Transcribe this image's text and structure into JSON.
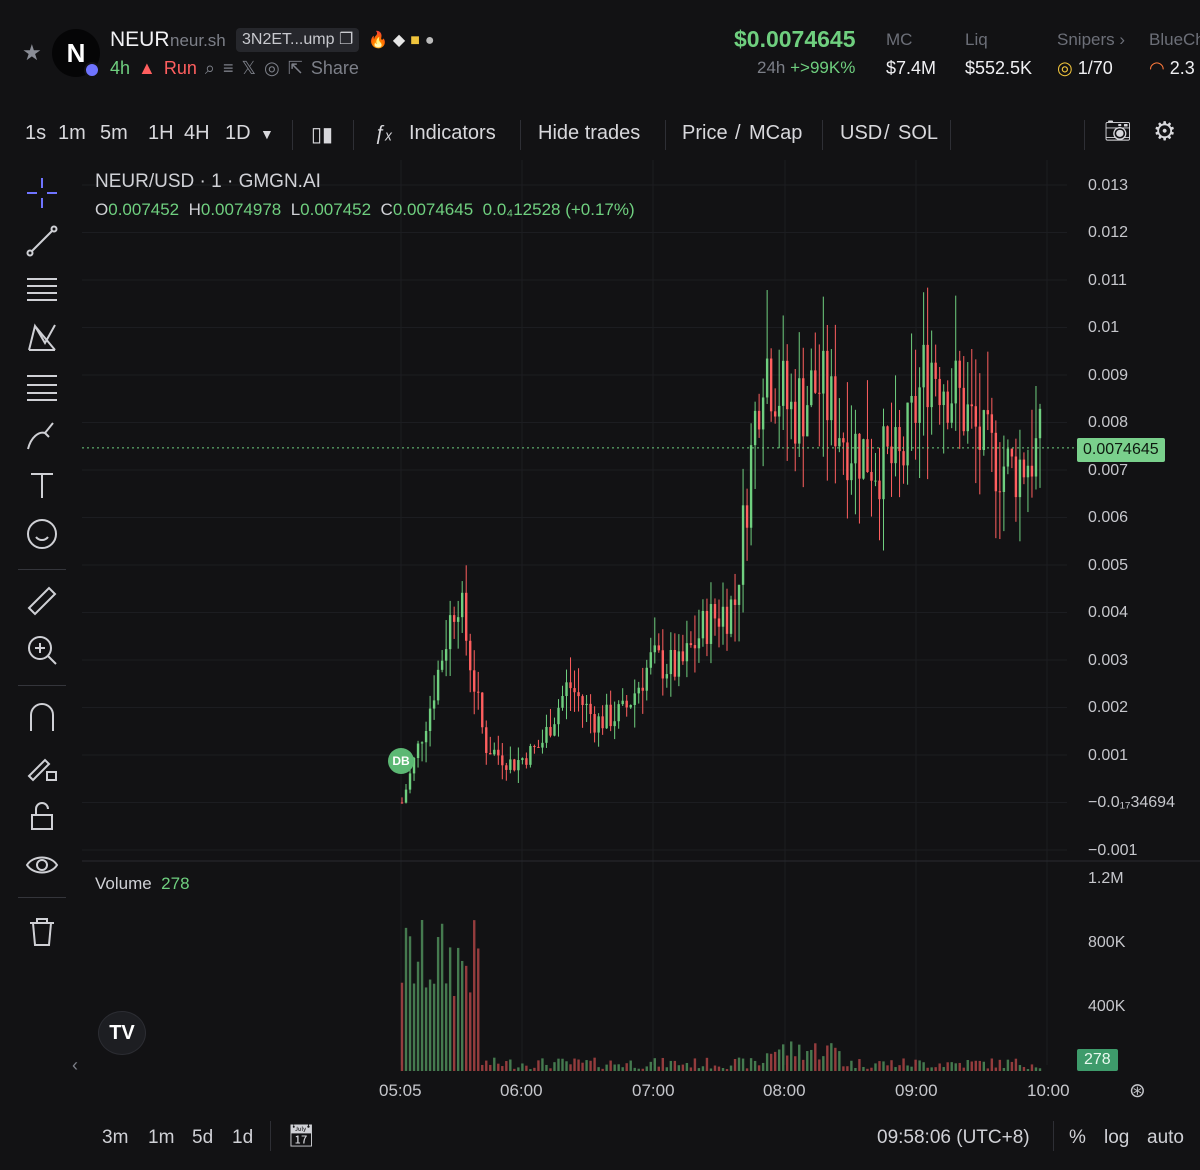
{
  "header": {
    "token_symbol": "NEUR",
    "website": "neur.sh",
    "address": "3N2ET...ump",
    "age": "4h",
    "run_label": "Run",
    "share_label": "Share",
    "price": "$0.0074645",
    "change_period": "24h",
    "change_value": "+>99K%",
    "stats": [
      {
        "label": "MC",
        "value": "$7.4M"
      },
      {
        "label": "Liq",
        "value": "$552.5K"
      },
      {
        "label": "Snipers",
        "value": "1/70"
      },
      {
        "label": "BlueCh",
        "value": "2.3"
      }
    ]
  },
  "toolbar": {
    "intervals": [
      "1s",
      "1m",
      "5m",
      "1H",
      "4H",
      "1D"
    ],
    "active_interval": "1H",
    "indicators_label": "Indicators",
    "hide_trades_label": "Hide trades",
    "price_label": "Price",
    "mcap_label": "MCap",
    "usd_label": "USD",
    "sol_label": "SOL"
  },
  "chart": {
    "pair_title": "NEUR/USD · 1 · GMGN.AI",
    "ohlc": {
      "o_label": "O",
      "o": "0.007452",
      "h_label": "H",
      "h": "0.0074978",
      "l_label": "L",
      "l": "0.007452",
      "c_label": "C",
      "c": "0.0074645",
      "change": "0.0₄12528 (+0.17%)"
    },
    "current_price_tag": "0.0074645",
    "price_axis": [
      "0.013",
      "0.012",
      "0.011",
      "0.01",
      "0.009",
      "0.008",
      "0.007",
      "0.006",
      "0.005",
      "0.004",
      "0.003",
      "0.002",
      "0.001",
      "−0.0₁₇34694",
      "−0.001"
    ],
    "volume_label": "Volume",
    "volume_value": "278",
    "volume_axis": [
      "1.2M",
      "800K",
      "400K"
    ],
    "volume_tag": "278",
    "marker_label": "DB",
    "time_axis": [
      "05:05",
      "06:00",
      "07:00",
      "08:00",
      "09:00",
      "10:00"
    ]
  },
  "bottom": {
    "ranges": [
      "3m",
      "1m",
      "5d",
      "1d"
    ],
    "clock": "09:58:06 (UTC+8)",
    "percent_label": "%",
    "log_label": "log",
    "auto_label": "auto"
  },
  "colors": {
    "up": "#6fcf7f",
    "down": "#ff5f5f",
    "accent": "#6f74ff",
    "background": "#121214"
  },
  "chart_data": {
    "type": "candlestick",
    "title": "NEUR/USD · 1 · GMGN.AI",
    "x": [
      "05:05",
      "05:15",
      "05:25",
      "05:35",
      "05:45",
      "06:00",
      "06:15",
      "06:30",
      "06:45",
      "07:00",
      "07:15",
      "07:30",
      "07:45",
      "08:00",
      "08:10",
      "08:20",
      "08:30",
      "08:45",
      "09:00",
      "09:10",
      "09:20",
      "09:30",
      "09:45",
      "10:00"
    ],
    "close": [
      0.0,
      0.002,
      0.0045,
      0.0012,
      0.0008,
      0.0012,
      0.0025,
      0.0017,
      0.0019,
      0.003,
      0.0028,
      0.0038,
      0.0042,
      0.0095,
      0.0082,
      0.0088,
      0.0077,
      0.0072,
      0.0071,
      0.0094,
      0.0086,
      0.0074,
      0.007,
      0.0074645
    ],
    "price_range": [
      -0.001,
      0.013
    ],
    "volume_range": [
      0,
      1200000
    ],
    "last_volume": 278
  }
}
